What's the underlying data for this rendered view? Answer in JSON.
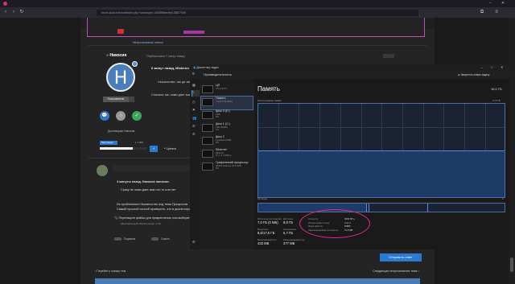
{
  "browser": {
    "url": "forum.4pda.to/forum/index.php?showtopic=1063598#entry135827345",
    "tab_dot_color": "#e0288c",
    "icons": [
      "back-icon",
      "forward-icon",
      "reload-icon",
      "extension-icon",
      "menu-icon"
    ]
  },
  "site": {
    "header_links": [
      "Добавить",
      "Mixteron"
    ],
    "header_icons": [
      "heart-icon",
      "bell-icon",
      "mail-icon",
      "comment-icon",
      "eye-icon",
      "search-icon"
    ],
    "sub_link": "Непрочитанные ответы"
  },
  "post1": {
    "username": "Никосия",
    "avatar_letter": "H",
    "date": "Опубликовано 7 минут назад",
    "quote_title": "6 минут назад, Mixteron",
    "reply_preview": "Ньюансство, так де замаче...",
    "reply_preview2": "Сначала так: зими дает вам что то",
    "badge": "Пользователь",
    "role": "Доставщики Никосия",
    "rep_label": "Репутация",
    "rep_value": "1 1 000",
    "quote_btn": "Цитата"
  },
  "post2": {
    "line1": "4 минуты назад, Никосия написал:",
    "line2": "Сразу не знаю дает вам что то или нет",
    "line3": "Из проблемного Ньюансство под тема Процессов",
    "line4": "Самый простой способ проверить, это в диспетчере",
    "attach": "Перетащите файлы для прикрепления, или выберите",
    "attach_sub": "Максимальный общий размер: 1.46"
  },
  "editor_toggles": [
    "Подписка",
    "Скрыть"
  ],
  "submit_button": "Отправить ответ",
  "nav": {
    "prev": "Перейти к списку тем",
    "next": "Следующая непрочитанная тема"
  },
  "taskmgr": {
    "title": "Диспетчер задач",
    "section": "Производительность",
    "run_task": "Запустить новую задачу",
    "items": [
      {
        "name": "ЦП",
        "sub": "7% 3,32 ГГц"
      },
      {
        "name": "Память",
        "sub": "7,0/17,5 ГБ (40%)"
      },
      {
        "name": "Диск 0 (D:)",
        "sub": "HDD\n0%"
      },
      {
        "name": "Диск 1 (C:)",
        "sub": "SSD (NVMe)\n1%"
      },
      {
        "name": "Диск 2",
        "sub": "Съемный (USB)\n0%"
      },
      {
        "name": "Ethernet",
        "sub": "Ethernet\nО: 0  П: 0 Кбит/с"
      },
      {
        "name": "Графический процессор",
        "sub": "NVIDIA GeForce GTX 1650\n0%"
      }
    ],
    "main_title": "Память",
    "main_total": "16,0 ГБ",
    "graph_top_label": "Использование памяти",
    "graph_top_value": "17,5 ГБ",
    "axis_left": "60 секунд",
    "axis_right": "0",
    "composition_label": "Структура памяти",
    "stats": [
      {
        "label": "Используется (сжатая)",
        "value": "7,0 ГБ (0 МБ)"
      },
      {
        "label": "Доступно",
        "value": "8,9 ГБ"
      },
      {
        "label": "Выделено",
        "value": "8,6/17,5 ГБ"
      },
      {
        "label": "Кэшировано",
        "value": "5,7 ГБ"
      },
      {
        "label": "Выгружаемый пул",
        "value": "433 МБ"
      },
      {
        "label": "Невыгружаемый пул",
        "value": "377 МБ"
      }
    ],
    "right_stats": [
      {
        "label": "Скорость:",
        "value": "3200 МГц"
      },
      {
        "label": "Использовано гнезд:",
        "value": "2 из 4"
      },
      {
        "label": "Форм-фактор:",
        "value": "DIMM"
      },
      {
        "label": "Зарезервировано аппаратно:",
        "value": "71,5 МБ"
      }
    ]
  }
}
